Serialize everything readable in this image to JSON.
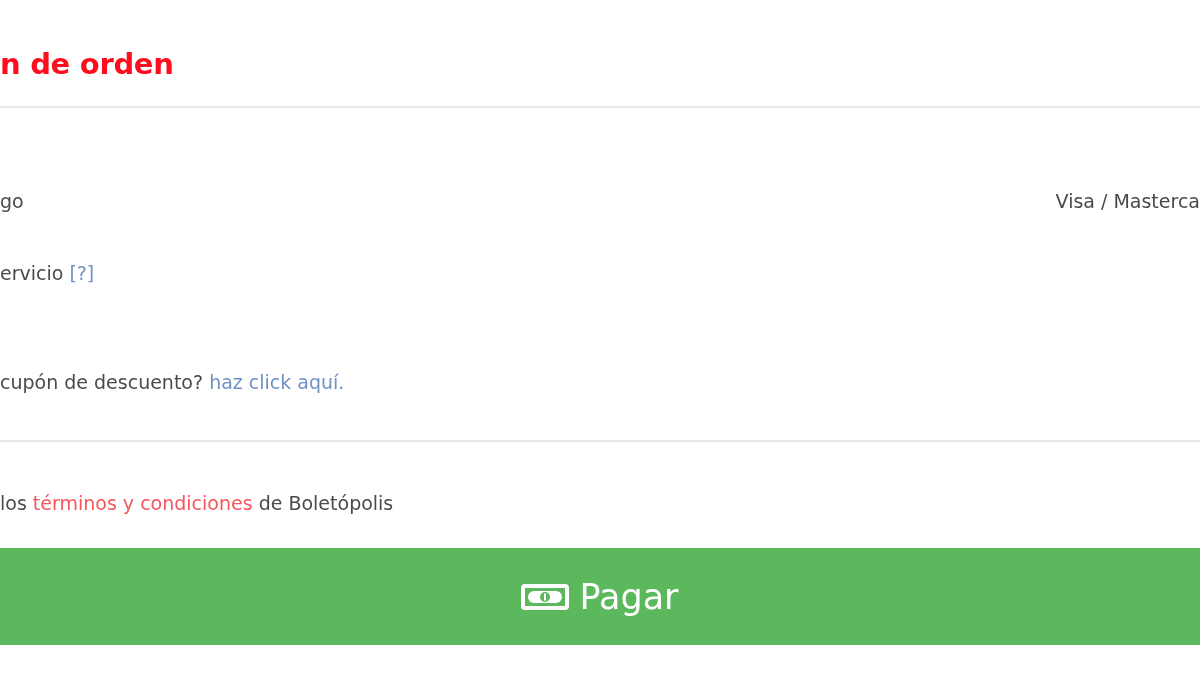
{
  "order_summary": {
    "title": "n de orden",
    "payment_row": {
      "label": "go",
      "value": "Visa / Masterca"
    },
    "service_row": {
      "label": "ervicio",
      "help_link": "[?]"
    },
    "coupon": {
      "text": "cupón de descuento?",
      "link": "haz click aquí."
    }
  },
  "terms": {
    "before": "los",
    "link": "términos y condiciones",
    "after": "de Boletópolis"
  },
  "pay_button": {
    "label": "Pagar"
  }
}
